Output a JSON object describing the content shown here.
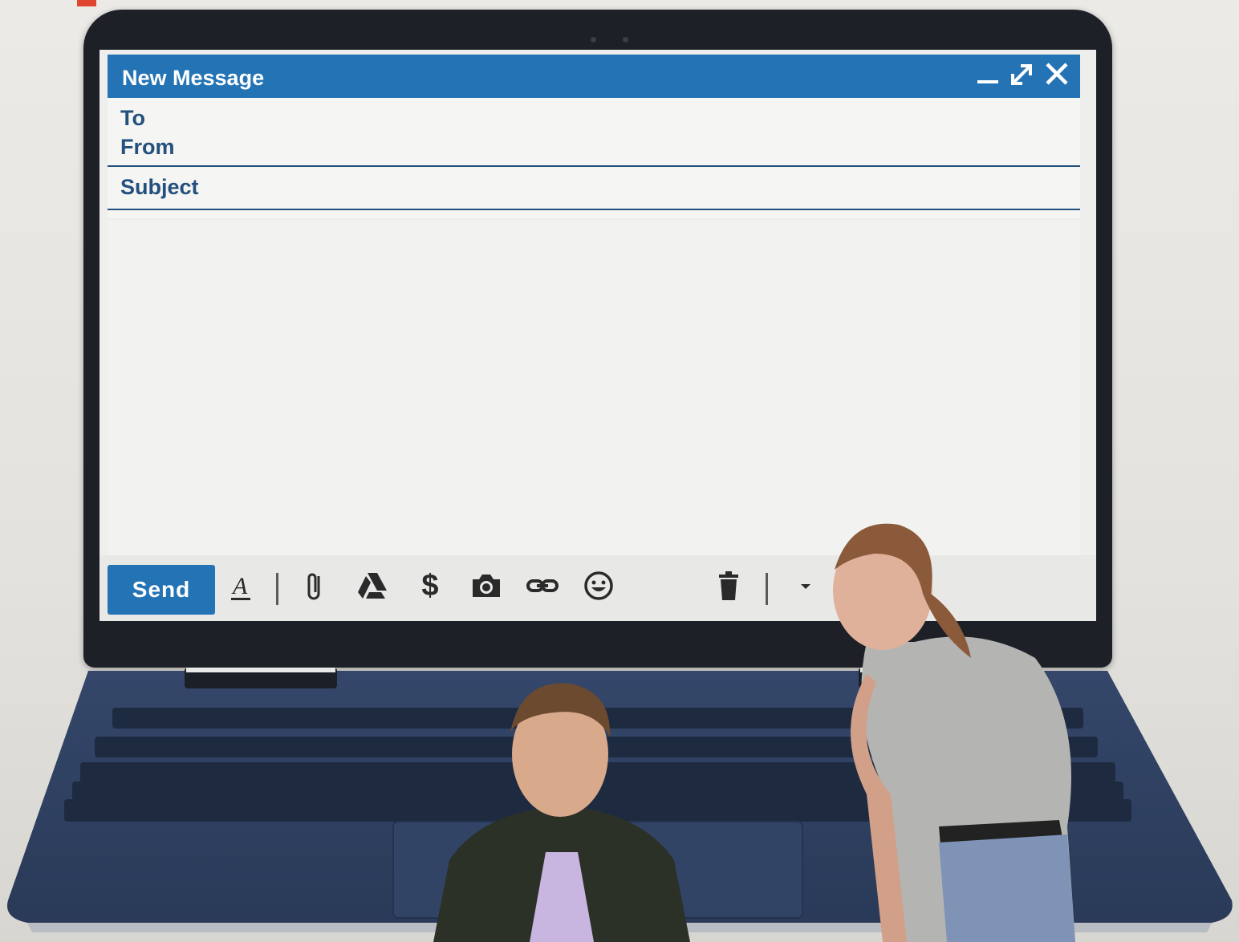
{
  "compose": {
    "title": "New Message",
    "fields": {
      "to_label": "To",
      "from_label": "From",
      "subject_label": "Subject"
    },
    "body_text": ""
  },
  "toolbar": {
    "send_label": "Send",
    "icons": [
      "formatting-icon",
      "attach-icon",
      "drive-icon",
      "money-icon",
      "camera-icon",
      "link-icon",
      "emoji-icon",
      "trash-icon",
      "more-options-icon"
    ]
  },
  "window_controls": [
    "minimize-icon",
    "expand-icon",
    "close-icon"
  ],
  "colors": {
    "accent": "#2474b5",
    "label": "#23507d",
    "laptop_body": "#2b3d5e"
  }
}
